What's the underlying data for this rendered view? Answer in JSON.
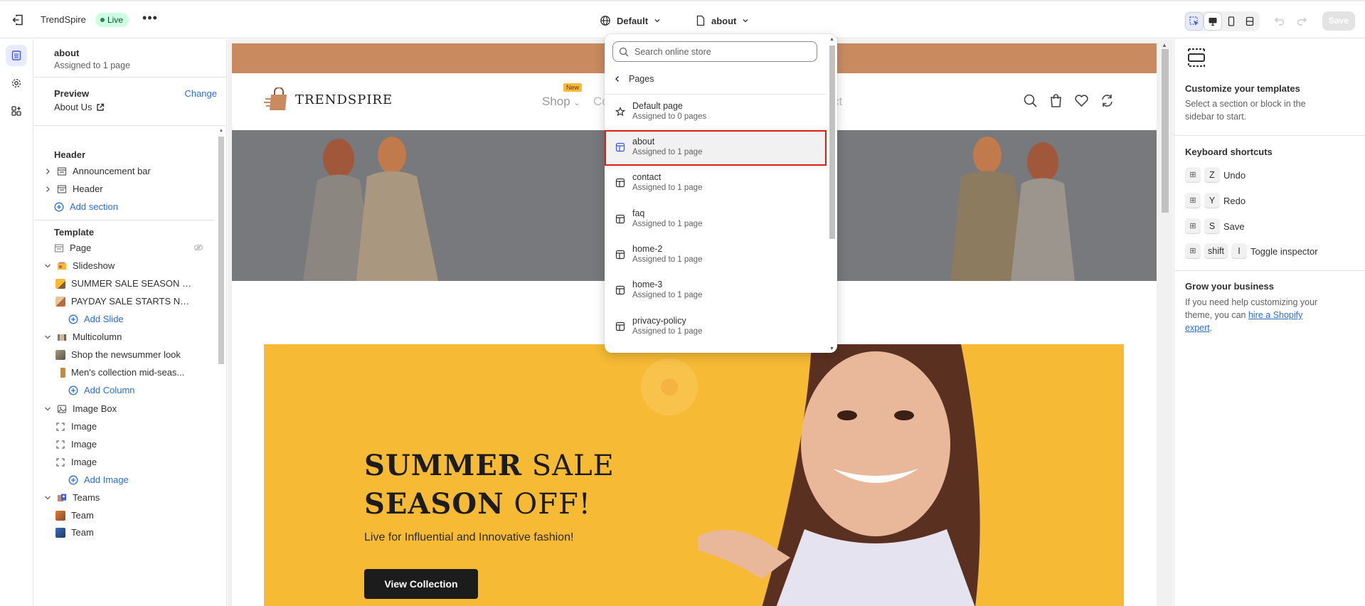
{
  "topbar": {
    "store_name": "TrendSpire",
    "live_badge": "Live",
    "more": "•••",
    "theme_selector": "Default",
    "page_selector": "about",
    "save": "Save"
  },
  "sidebar": {
    "title": "about",
    "subtitle": "Assigned to 1 page",
    "preview_label": "Preview",
    "preview_change": "Change",
    "preview_value": "About Us",
    "header_group": "Header",
    "header_items": [
      "Announcement bar",
      "Header"
    ],
    "add_section": "Add section",
    "template_group": "Template",
    "page_item": "Page",
    "slideshow": "Slideshow",
    "slides": [
      "SUMMER SALE SEASON O...",
      "PAYDAY SALE STARTS NOW"
    ],
    "add_slide": "Add Slide",
    "multicolumn": "Multicolumn",
    "columns": [
      "Shop the newsummer look",
      "Men's collection mid-seas..."
    ],
    "add_column": "Add Column",
    "image_box": "Image Box",
    "images": [
      "Image",
      "Image",
      "Image"
    ],
    "add_image": "Add Image",
    "teams": "Teams",
    "team_items": [
      "Team",
      "Team"
    ]
  },
  "store": {
    "logo": "TRENDSPIRE",
    "nav_shop": "Shop",
    "nav_new": "New",
    "nav_c": "Co",
    "nav_ct": "ct",
    "banner_title_bold_1": "SUMMER",
    "banner_title_reg_1": "SALE",
    "banner_title_bold_2": "SEASON",
    "banner_title_reg_2": "OFF!",
    "banner_sub": "Live for Influential and Innovative fashion!",
    "banner_button": "View Collection"
  },
  "dropdown": {
    "search_placeholder": "Search online store",
    "back_label": "Pages",
    "items": [
      {
        "title": "Default page",
        "sub": "Assigned to 0 pages"
      },
      {
        "title": "about",
        "sub": "Assigned to 1 page"
      },
      {
        "title": "contact",
        "sub": "Assigned to 1 page"
      },
      {
        "title": "faq",
        "sub": "Assigned to 1 page"
      },
      {
        "title": "home-2",
        "sub": "Assigned to 1 page"
      },
      {
        "title": "home-3",
        "sub": "Assigned to 1 page"
      },
      {
        "title": "privacy-policy",
        "sub": "Assigned to 1 page"
      }
    ]
  },
  "rpanel": {
    "customize_title": "Customize your templates",
    "customize_text": "Select a section or block in the sidebar to start.",
    "shortcuts_title": "Keyboard shortcuts",
    "shortcuts": [
      {
        "keys": [
          "Z"
        ],
        "label": "Undo"
      },
      {
        "keys": [
          "Y"
        ],
        "label": "Redo"
      },
      {
        "keys": [
          "S"
        ],
        "label": "Save"
      },
      {
        "keys": [
          "shift",
          "I"
        ],
        "label": "Toggle inspector"
      }
    ],
    "grow_title": "Grow your business",
    "grow_text": "If you need help customizing your theme, you can",
    "grow_link": "hire a Shopify expert",
    "grow_end": "."
  },
  "colors": {
    "accent": "#2c6ecb",
    "announcement": "#c98a60",
    "banner": "#f6ba34",
    "highlight": "#e01b1b"
  }
}
